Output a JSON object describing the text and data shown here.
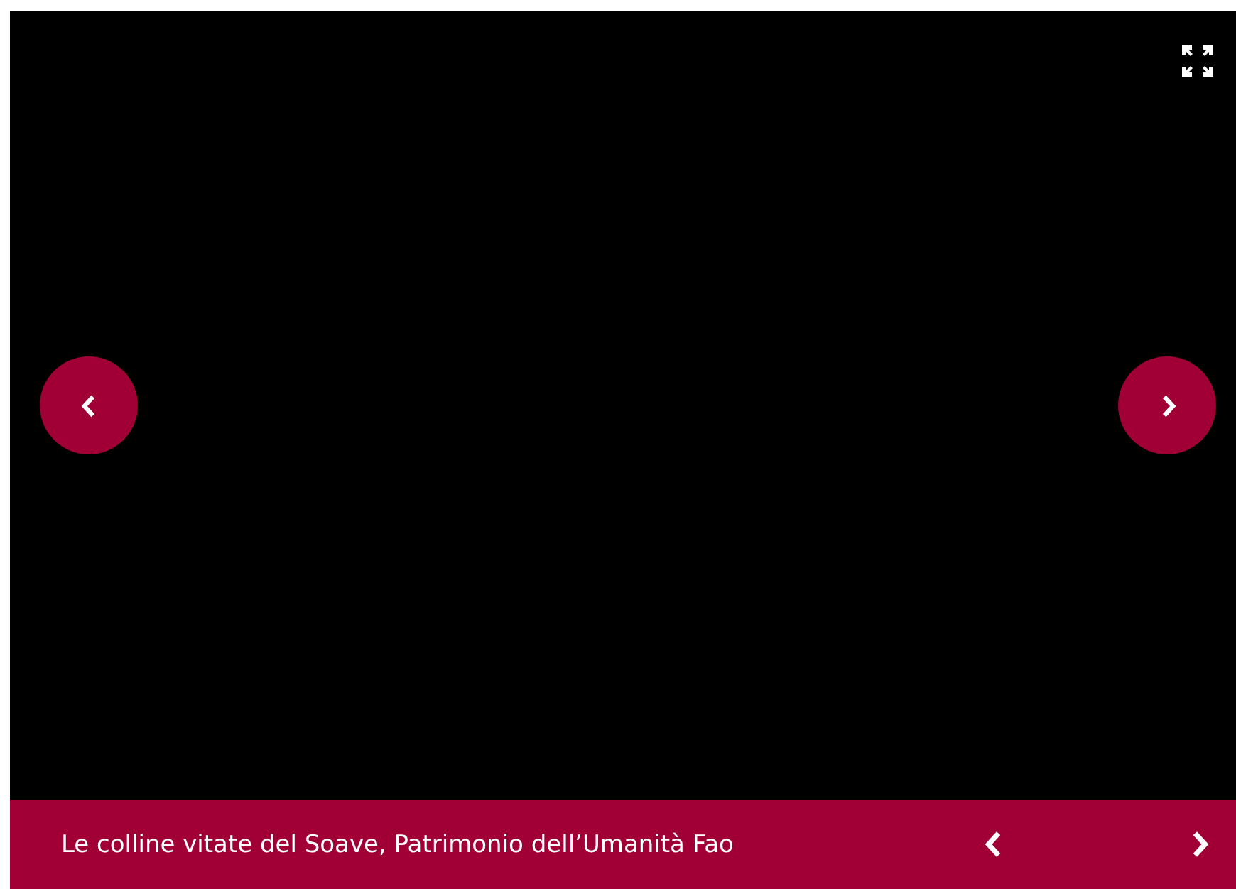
{
  "slideshow": {
    "caption": "Le colline vitate del Soave, Patrimonio dell’Umanità Fao"
  }
}
